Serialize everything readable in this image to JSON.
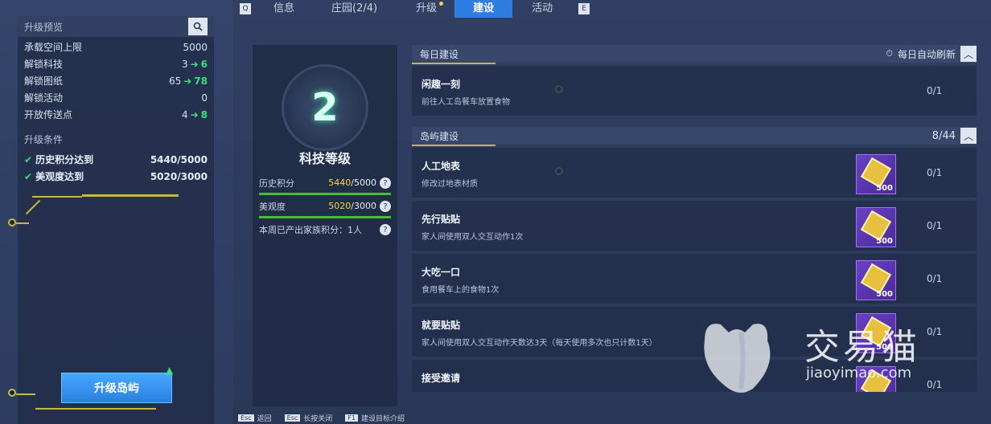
{
  "tabs": {
    "key_left": "Q",
    "key_right": "E",
    "items": [
      "信息",
      "庄园(2/4)",
      "升级",
      "建设",
      "活动"
    ]
  },
  "left": {
    "title": "升级预览",
    "rows": [
      {
        "label": "承载空间上限",
        "value": "5000",
        "new": ""
      },
      {
        "label": "解锁科技",
        "value": "3",
        "new": "6"
      },
      {
        "label": "解锁图纸",
        "value": "65",
        "new": "78"
      },
      {
        "label": "解锁活动",
        "value": "0",
        "new": ""
      },
      {
        "label": "开放传送点",
        "value": "4",
        "new": "8"
      }
    ],
    "cond_title": "升级条件",
    "conditions": [
      {
        "label": "历史积分达到",
        "value": "5440/5000"
      },
      {
        "label": "美观度达到",
        "value": "5020/3000"
      }
    ],
    "upgrade_label": "升级岛屿"
  },
  "mid": {
    "level": "2",
    "title": "科技等级",
    "hist_label": "历史积分",
    "hist_val": "5440",
    "hist_max": "/5000",
    "beauty_label": "美观度",
    "beauty_val": "5020",
    "beauty_max": "/3000",
    "weekly_label": "本周已产出家族积分：1人"
  },
  "daily": {
    "title": "每日建设",
    "refresh": "每日自动刷新",
    "tasks": [
      {
        "name": "闲趣一刻",
        "desc": "前往人工岛餐车放置食物",
        "count": "0/1"
      }
    ]
  },
  "island": {
    "title": "岛屿建设",
    "progress": "8/44",
    "tasks": [
      {
        "name": "人工地表",
        "desc": "修改过地表材质",
        "count": "0/1",
        "reward": "500"
      },
      {
        "name": "先行贴贴",
        "desc": "家人间使用双人交互动作1次",
        "count": "0/1",
        "reward": "500"
      },
      {
        "name": "大吃一口",
        "desc": "食用餐车上的食物1次",
        "count": "0/1",
        "reward": "500"
      },
      {
        "name": "就要贴贴",
        "desc": "家人间使用双人交互动作天数达3天（每天使用多次也只计数1天）",
        "count": "0/1",
        "reward": "500"
      },
      {
        "name": "接受邀请",
        "desc": "",
        "count": "0/1",
        "reward": "500"
      }
    ]
  },
  "hints": [
    {
      "key": "Esc",
      "label": "返回"
    },
    {
      "key": "Esc",
      "label": "长按关闭"
    },
    {
      "key": "F1",
      "label": "建设目标介绍"
    }
  ],
  "watermark": {
    "text": "交易猫",
    "sub": "jiaoyimao.com"
  },
  "colors": {
    "accent": "#2e7de0",
    "green": "#3ce07a",
    "gold": "#f5d742",
    "purple": "#6a40c8"
  }
}
